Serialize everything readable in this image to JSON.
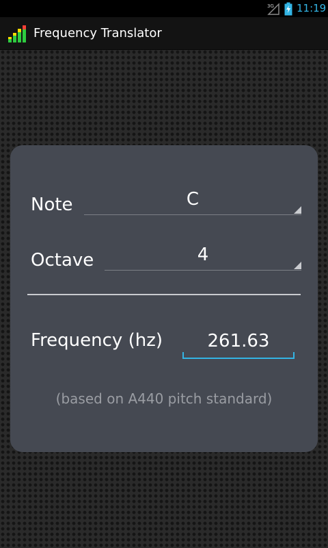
{
  "status_bar": {
    "network": "3G",
    "time": "11:19"
  },
  "action_bar": {
    "title": "Frequency Translator"
  },
  "form": {
    "note_label": "Note",
    "note_value": "C",
    "octave_label": "Octave",
    "octave_value": "4",
    "frequency_label": "Frequency (hz)",
    "frequency_value": "261.63",
    "footnote": "(based on A440 pitch standard)"
  },
  "colors": {
    "accent": "#33b5e5",
    "card": "#454952",
    "background": "#2a2a2a"
  },
  "icons": [
    "signal-icon",
    "battery-icon",
    "app-icon",
    "spinner-arrow-icon"
  ]
}
